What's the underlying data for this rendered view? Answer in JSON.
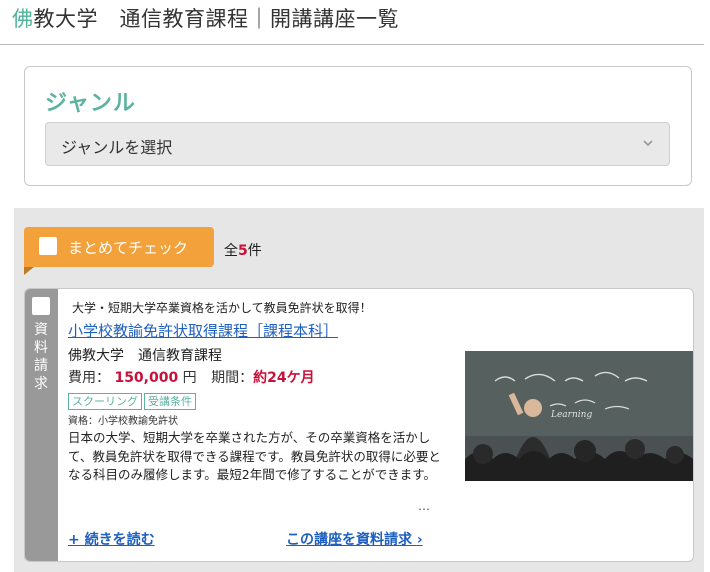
{
  "header": {
    "title_accent": "佛",
    "title_rest": "教大学　通信教育課程｜開講講座一覧"
  },
  "genre": {
    "label": "ジャンル",
    "select_value": "ジャンルを選択"
  },
  "results": {
    "bulk_check_label": "まとめてチェック",
    "count_prefix": "全",
    "count": "5",
    "count_suffix": "件"
  },
  "card": {
    "side_label": "資料請求",
    "tagline": "大学・短期大学卒業資格を活かして教員免許状を取得！",
    "course_title": "小学校教諭免許状取得課程［課程本科］",
    "university": "佛教大学　通信教育課程",
    "fee_label": "費用：",
    "fee_value": "150,000",
    "fee_unit": "円",
    "period_label": "期間：",
    "period_value": "約24ケ月",
    "tags": [
      "スクーリング",
      "受講条件"
    ],
    "qualification": "資格：小学校教諭免許状",
    "description": "日本の大学、短期大学を卒業された方が、その卒業資格を活かして、教員免許状を取得できる課程です。教員免許状の取得に必要となる科目のみ履修します。最短2年間で修了することができます。",
    "ellipsis": "…",
    "read_more": "+ 続きを読む",
    "request_link": "この講座を資料請求",
    "photo_board_text": "Learning"
  },
  "colors": {
    "accent_green": "#5cb3a1",
    "orange": "#f2a13b",
    "link_blue": "#1e5fbf",
    "price_red": "#c8103a"
  }
}
